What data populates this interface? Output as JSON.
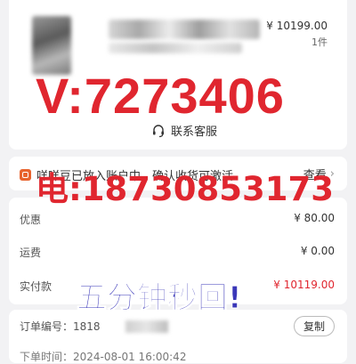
{
  "product": {
    "price": "¥ 10199.00",
    "quantity": "1件"
  },
  "customer_service": {
    "label": "联系客服",
    "icon": "headset-icon"
  },
  "notice": {
    "text": "咩咩豆已放入账户中，确认收货可激活",
    "view_label": "查看",
    "icon": "bean-icon"
  },
  "costs": {
    "discount_label": "优惠",
    "discount_value": "¥ 80.00",
    "shipping_label": "运费",
    "shipping_value": "¥ 0.00",
    "paid_label": "实付款",
    "paid_value": "¥ 10119.00"
  },
  "order": {
    "number_label": "订单编号：1818",
    "copy_label": "复制",
    "time_label": "下单时间：2024-08-01 16:00:42"
  },
  "overlay": {
    "wechat_text": "V:7273406",
    "phone_text": "电:18730853173",
    "reply_text": "五分钟秒回!"
  },
  "colors": {
    "accent_red": "#e0262f",
    "overlay_blue": "#3a37b8"
  }
}
